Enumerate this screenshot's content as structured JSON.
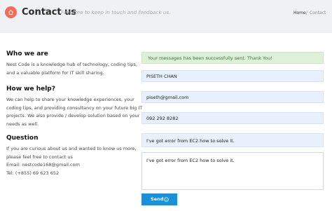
{
  "header": {
    "title": "Contact us",
    "subtitle": "Feel free to keep in touch and feedback us.",
    "breadcrumb": {
      "home": "Home",
      "separator": "/",
      "current": "Contact"
    },
    "icon": "home-icon",
    "accent_color": "#f26b5b"
  },
  "info": {
    "who": {
      "heading": "Who we are",
      "lines": [
        "Nest Code is a knowledge hub of technology, coding tips,",
        "and a valuable platform for IT skill sharing."
      ]
    },
    "how": {
      "heading": "How we help?",
      "lines": [
        "We can help to share your knowledge experiences, your",
        "coding tips, and providing consultancy on your future big IT",
        "projects. We also provide / develop solution based on your",
        "needs as well."
      ]
    },
    "question": {
      "heading": "Question",
      "lines": [
        "If you are curious about us and wanted to know us more,",
        "please feel free to contact us",
        "Email: nestcode168@gmail.com",
        "Tel: (+855) 69 623 652"
      ]
    }
  },
  "form": {
    "success_message": "Your messages has been successfully sent. Thank You!",
    "name": "PISETH CHAN",
    "email": "piseth@gmail.com",
    "phone": "092 292 8282",
    "subject": "I've got error from EC2 how to solve it.",
    "message": "I've got error from EC2 how to solve it.",
    "send_label": "Send",
    "send_icon": "smile-icon",
    "button_color": "#1e8fd6",
    "success_color": "#dff0d8"
  }
}
